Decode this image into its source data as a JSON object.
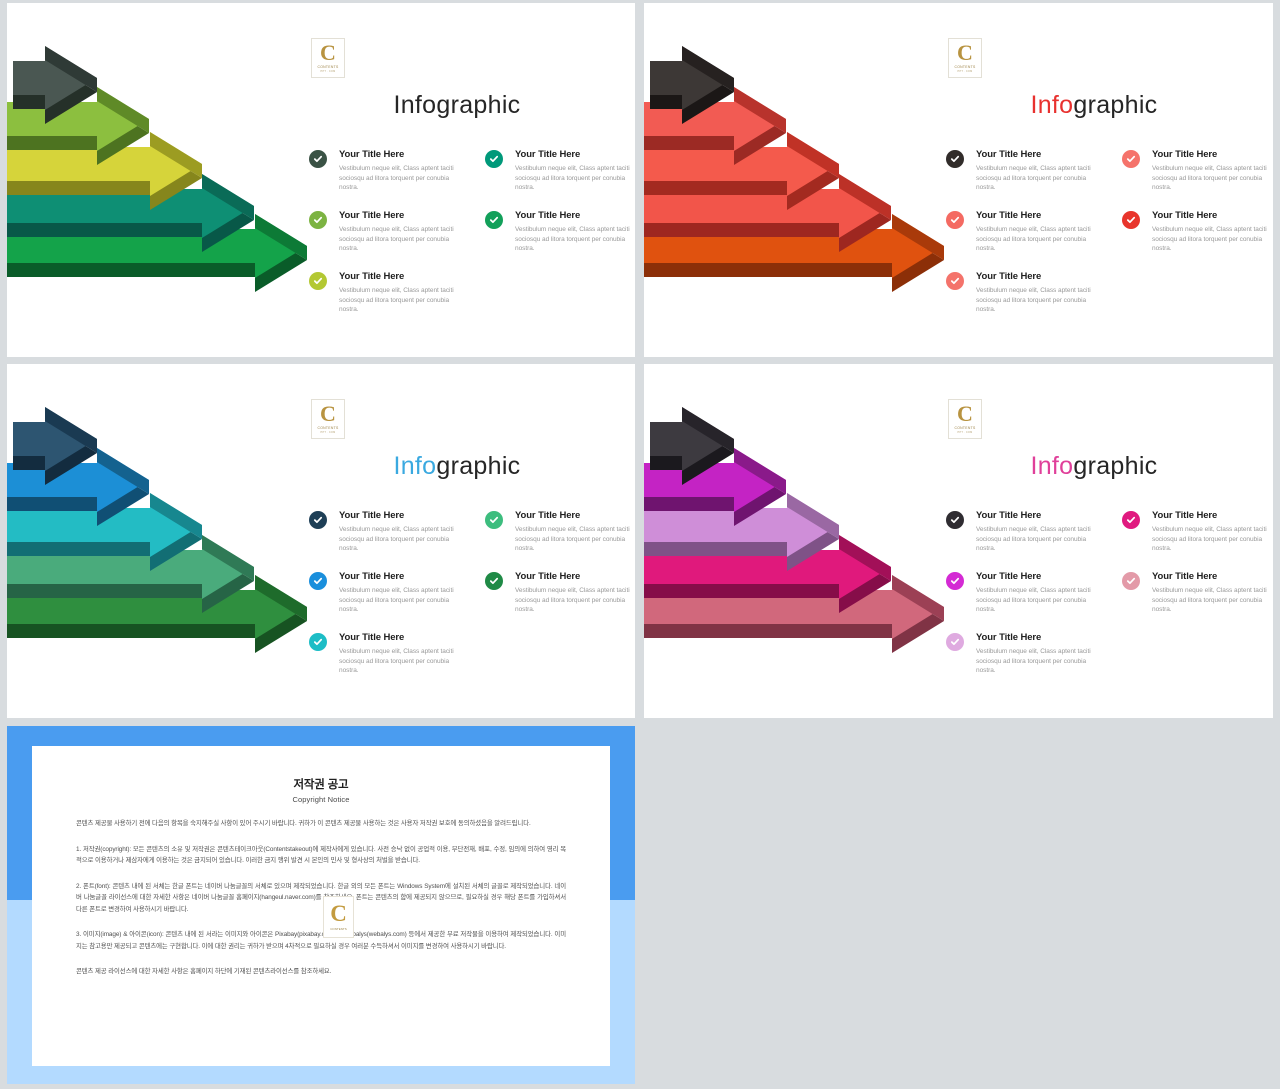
{
  "deck": {
    "title_prefix": "Info",
    "title_suffix": "graphic"
  },
  "bullet_text": {
    "title": "Your Title Here",
    "body": "Vestibulum neque elit, Class aptent taciti sociosqu ad litora torquent per conubia nostra."
  },
  "watermark": {
    "letter": "C",
    "line1": "CONTENTS",
    "line2": "PPT . COM"
  },
  "slides": [
    {
      "name": "green",
      "accent": "#5a9e3f",
      "title_prefix": "Info",
      "title_suffix": "graphic",
      "arrows": [
        {
          "top": "#4a5752",
          "side": "#2f3a36",
          "front": "#253029"
        },
        {
          "top": "#8cbf3f",
          "side": "#5f8a27",
          "front": "#4d7320"
        },
        {
          "top": "#d6d43a",
          "side": "#9c9c22",
          "front": "#86861c"
        },
        {
          "top": "#0e8f74",
          "side": "#0a6b57",
          "front": "#085848"
        },
        {
          "top": "#14a34a",
          "side": "#0d7a36",
          "front": "#0a5c29"
        }
      ],
      "marks": [
        "#3a5245",
        "#7cb342",
        "#b3c833",
        "#00997a",
        "#12a05a"
      ]
    },
    {
      "name": "red",
      "accent": "#e8312f",
      "title_prefix": "Info",
      "title_suffix": "graphic",
      "arrows": [
        {
          "top": "#3d3836",
          "side": "#262120",
          "front": "#1b1716"
        },
        {
          "top": "#f25b53",
          "side": "#b8332c",
          "front": "#9c2a24"
        },
        {
          "top": "#f45a4c",
          "side": "#c03226",
          "front": "#a32a20"
        },
        {
          "top": "#f2554a",
          "side": "#bc3127",
          "front": "#9e2720"
        },
        {
          "top": "#e0520f",
          "side": "#a93a0a",
          "front": "#8c2f08"
        }
      ],
      "marks": [
        "#312c2a",
        "#f46a62",
        "#f5736b",
        "#e8352c",
        "#f4736b"
      ]
    },
    {
      "name": "blue",
      "accent": "#3aa9e0",
      "title_prefix": "Info",
      "title_suffix": "graphic",
      "arrows": [
        {
          "top": "#2d5571",
          "side": "#1a3a52",
          "front": "#132c3f"
        },
        {
          "top": "#1c8fd6",
          "side": "#14628f",
          "front": "#104f74"
        },
        {
          "top": "#23bcc4",
          "side": "#17878f",
          "front": "#126e74"
        },
        {
          "top": "#4aab7c",
          "side": "#2f7a56",
          "front": "#266446"
        },
        {
          "top": "#2f8f3f",
          "side": "#1e6b2b",
          "front": "#175322"
        }
      ],
      "marks": [
        "#1e3f56",
        "#1a8fdc",
        "#1dbdc6",
        "#3dbd7e",
        "#1f8a46"
      ]
    },
    {
      "name": "purple",
      "accent": "#e0409a",
      "title_prefix": "Info",
      "title_suffix": "graphic",
      "arrows": [
        {
          "top": "#3d3a40",
          "side": "#27242a",
          "front": "#1b191e"
        },
        {
          "top": "#c423c4",
          "side": "#8a1a8a",
          "front": "#6f146f"
        },
        {
          "top": "#cf8ed8",
          "side": "#9a68a3",
          "front": "#7f5287"
        },
        {
          "top": "#e0197c",
          "side": "#a21058",
          "front": "#860d49"
        },
        {
          "top": "#d1687c",
          "side": "#9c4055",
          "front": "#803345"
        }
      ],
      "marks": [
        "#2f2c31",
        "#d42ad4",
        "#dfaae0",
        "#e01a7f",
        "#e39aa8"
      ]
    }
  ],
  "copyright": {
    "heading_ko": "저작권 공고",
    "heading_en": "Copyright Notice",
    "paragraphs": [
      "콘텐츠 제공물 사용하기 전에 다음의 항목을 숙지해주실 사항이 있어 주시기 바랍니다. 귀하가 이 콘텐츠 제공물 사용하는 것은 사용자 저작권 보호에 동의하셨음을 알려드립니다.",
      "1. 저작권(copyright): 모든 콘텐츠의 소유 및 저작권은 콘텐츠테이크아웃(Contentstakeout)에 제작사에게 있습니다. 사전 승낙 없이 공업적 이용, 무단전재, 배포, 수정, 임의에 의하여 영리 목적으로 이용하거나 제삼자에게 이용하는 것은 금지되어 있습니다. 이러한 금지 행위 발견 시 본인의 민사 및 형사상의 처벌을 받습니다.",
      "2. 폰트(font): 콘텐츠 내에 된 서체는 한글 폰트는 네이버 나눔글꼴의 서체로 있으며 제작되었습니다. 한글 외의 모든 폰트는 Windows System에 설치된 서체의 글꼴로 제작되었습니다. 네이버 나눔글꼴 라이선스에 대한 자세한 사항은 네이버 나눔글꼴 홈페이지(hangeul.naver.com)를 참조하세요. 폰트는 콘텐츠의 함에 제공되지 않으므로, 필요하실 경우 해당 폰트를 가입하셔서 다른 폰트로 변경하여 사용하시기 바랍니다.",
      "3. 이미지(image) & 아이콘(icon): 콘텐츠 내에 된 서라는 이미지와 아이콘은 Pixabay(pixabay.com)와 Webalys(webalys.com) 등에서 제공한 무료 저작물을 이용하여 제작되었습니다. 이미지는 참고용만 제공되고 콘텐츠에는 구현합니다. 이에 대한 권리는 귀하가 받으며 4차적으로 필요하실 경우 여러분 수득하셔서 이미지를 변경하여 사용하시기 바랍니다.",
      "콘텐츠 제공 라이선스에 대한 자세한 사항은 홈페이지 하단에 기재된 콘텐츠라이선스를 참조하세요."
    ]
  }
}
